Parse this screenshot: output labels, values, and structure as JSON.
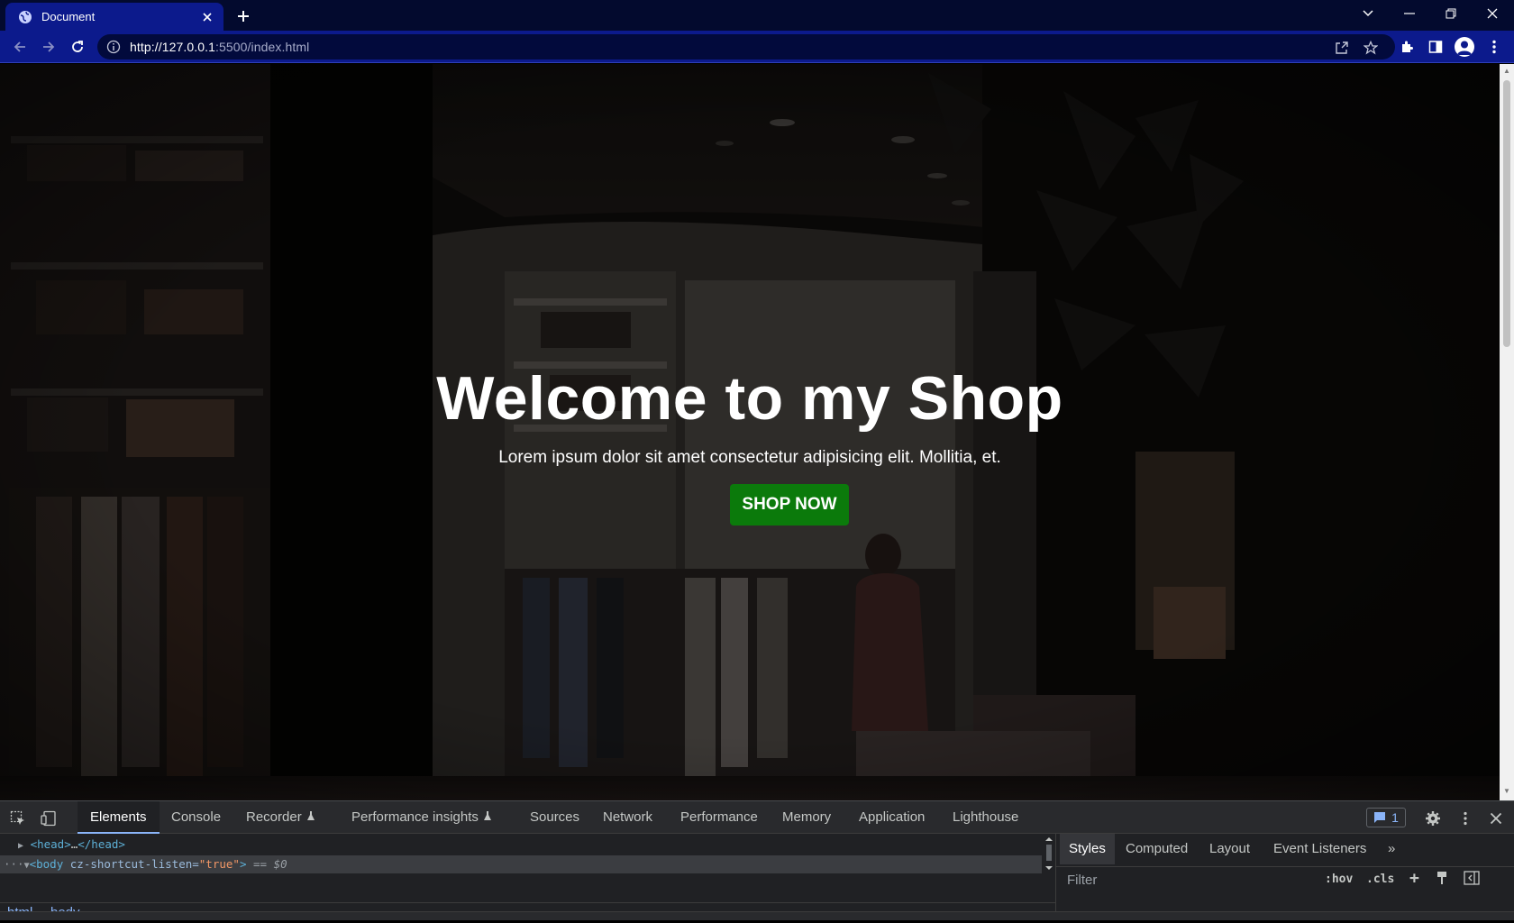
{
  "browser": {
    "tab_title": "Document",
    "url_host": "http://127.0.0.1",
    "url_rest": ":5500/index.html"
  },
  "hero": {
    "title": "Welcome to my Shop",
    "subtitle": "Lorem ipsum dolor sit amet consectetur adipisicing elit. Mollitia, et.",
    "button_label": "SHOP NOW",
    "button_color": "#0b7a0b"
  },
  "devtools": {
    "tabs": [
      "Elements",
      "Console",
      "Recorder",
      "Performance insights",
      "Sources",
      "Network",
      "Performance",
      "Memory",
      "Application",
      "Lighthouse"
    ],
    "issues_count": "1",
    "dom": {
      "head_open": "<head>",
      "head_ellipsis": "…",
      "head_close": "</head>",
      "body_tag_open": "<body",
      "body_attr_name": "cz-shortcut-listen",
      "body_attr_eq": "=",
      "body_attr_value": "\"true\"",
      "body_tag_close": ">",
      "body_eq": "== $0",
      "row_ellipsis": "···"
    },
    "breadcrumb": [
      "html",
      "body"
    ],
    "styles_tabs": [
      "Styles",
      "Computed",
      "Layout",
      "Event Listeners"
    ],
    "filter_placeholder": "Filter",
    "hov_label": ":hov",
    "cls_label": ".cls"
  },
  "icons": {
    "favicon": "globe-icon",
    "accent": "#0c1a8c"
  }
}
